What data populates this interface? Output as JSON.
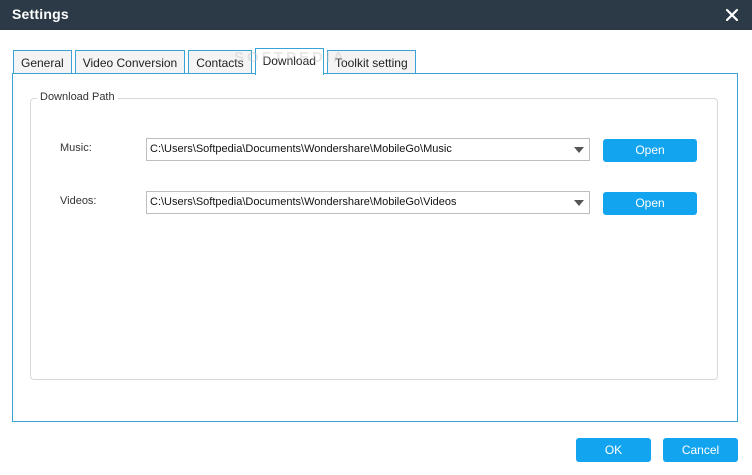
{
  "window": {
    "title": "Settings",
    "close_icon": "close-icon"
  },
  "tabs": [
    {
      "label": "General",
      "active": false
    },
    {
      "label": "Video Conversion",
      "active": false
    },
    {
      "label": "Contacts",
      "active": false
    },
    {
      "label": "Download",
      "active": true
    },
    {
      "label": "Toolkit setting",
      "active": false
    }
  ],
  "download_path": {
    "group_title": "Download Path",
    "music": {
      "label": "Music:",
      "value": "C:\\Users\\Softpedia\\Documents\\Wondershare\\MobileGo\\Music",
      "open_label": "Open"
    },
    "videos": {
      "label": "Videos:",
      "value": "C:\\Users\\Softpedia\\Documents\\Wondershare\\MobileGo\\Videos",
      "open_label": "Open"
    }
  },
  "footer": {
    "ok_label": "OK",
    "cancel_label": "Cancel"
  },
  "watermark": "SOFTPEDIA",
  "colors": {
    "titlebar": "#2b3a46",
    "accent": "#13a4ef",
    "border": "#3aa3d6"
  }
}
